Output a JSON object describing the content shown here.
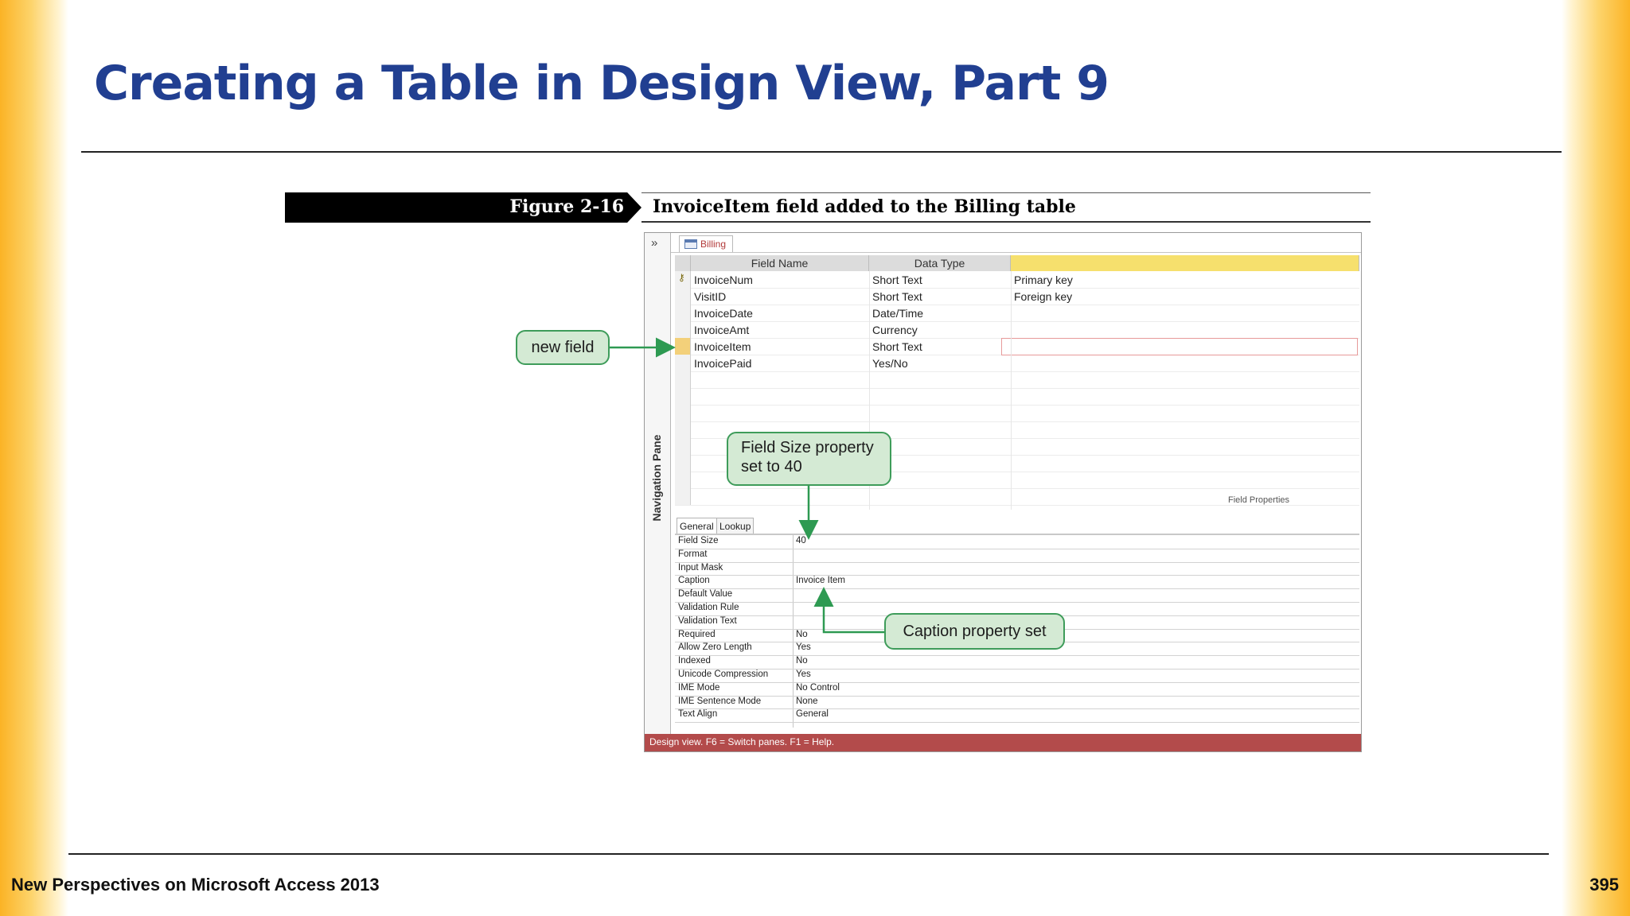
{
  "slide": {
    "title": "Creating a Table in Design View, Part 9",
    "footer": "New Perspectives on Microsoft Access 2013",
    "page_number": "395"
  },
  "figure": {
    "label": "Figure 2-16",
    "caption": "InvoiceItem field added to the Billing table"
  },
  "access": {
    "nav_chevron": "»",
    "nav_pane_label": "Navigation Pane",
    "table_tab": "Billing",
    "columns": [
      "Field Name",
      "Data Type",
      ""
    ],
    "rows": [
      {
        "name": "InvoiceNum",
        "type": "Short Text",
        "desc": "Primary key",
        "is_key": true
      },
      {
        "name": "VisitID",
        "type": "Short Text",
        "desc": "Foreign key",
        "is_key": false
      },
      {
        "name": "InvoiceDate",
        "type": "Date/Time",
        "desc": "",
        "is_key": false
      },
      {
        "name": "InvoiceAmt",
        "type": "Currency",
        "desc": "",
        "is_key": false
      },
      {
        "name": "InvoiceItem",
        "type": "Short Text",
        "desc": "",
        "is_key": false
      },
      {
        "name": "InvoicePaid",
        "type": "Yes/No",
        "desc": "",
        "is_key": false
      }
    ],
    "field_properties_label": "Field Properties",
    "property_tabs": [
      "General",
      "Lookup"
    ],
    "properties": [
      {
        "name": "Field Size",
        "value": "40"
      },
      {
        "name": "Format",
        "value": ""
      },
      {
        "name": "Input Mask",
        "value": ""
      },
      {
        "name": "Caption",
        "value": "Invoice Item"
      },
      {
        "name": "Default Value",
        "value": ""
      },
      {
        "name": "Validation Rule",
        "value": ""
      },
      {
        "name": "Validation Text",
        "value": ""
      },
      {
        "name": "Required",
        "value": "No"
      },
      {
        "name": "Allow Zero Length",
        "value": "Yes"
      },
      {
        "name": "Indexed",
        "value": "No"
      },
      {
        "name": "Unicode Compression",
        "value": "Yes"
      },
      {
        "name": "IME Mode",
        "value": "No Control"
      },
      {
        "name": "IME Sentence Mode",
        "value": "None"
      },
      {
        "name": "Text Align",
        "value": "General"
      }
    ],
    "status_text": "Design view.  F6 = Switch panes.  F1 = Help."
  },
  "callouts": {
    "new_field": "new field",
    "field_size": "Field Size property set to 40",
    "caption": "Caption property set"
  },
  "colors": {
    "title": "#213f91",
    "callout_fill": "#d4ead4",
    "callout_border": "#3e9c5a",
    "status_bar": "#b34b4b",
    "header_highlight": "#f6e06d"
  }
}
